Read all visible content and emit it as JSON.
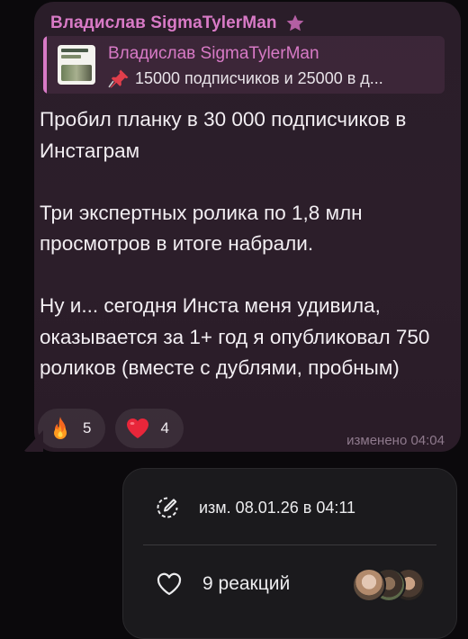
{
  "message": {
    "sender_name": "Владислав SigmaTylerMan",
    "reply": {
      "author": "Владислав SigmaTylerMan",
      "text": "15000 подписчиков и 25000 в д..."
    },
    "paragraphs": [
      "Пробил планку в 30 000 подписчиков в Инстаграм",
      "Три экспертных ролика по 1,8 млн просмотров в итоге набрали.",
      "Ну и... сегодня Инста меня удивила, оказывается за 1+ год я опубликовал 750 роликов (вместе с дублями, пробным)"
    ],
    "reactions": [
      {
        "emoji": "fire",
        "count": "5"
      },
      {
        "emoji": "heart",
        "count": "4"
      }
    ],
    "edited_label": "изменено 04:04"
  },
  "context_card": {
    "edited_text": "изм. 08.01.26 в 04:11",
    "reactions_text": "9 реакций"
  },
  "icons": {
    "premium": "star-icon",
    "pin": "pushpin-icon",
    "fire": "fire-icon",
    "heart": "heart-icon",
    "edit": "edit-clock-icon",
    "reactions": "heart-outline-icon"
  },
  "colors": {
    "background": "#0b090c",
    "bubble": "#2a1d29",
    "accent": "#d87ac6",
    "card": "#1b1a1d"
  }
}
